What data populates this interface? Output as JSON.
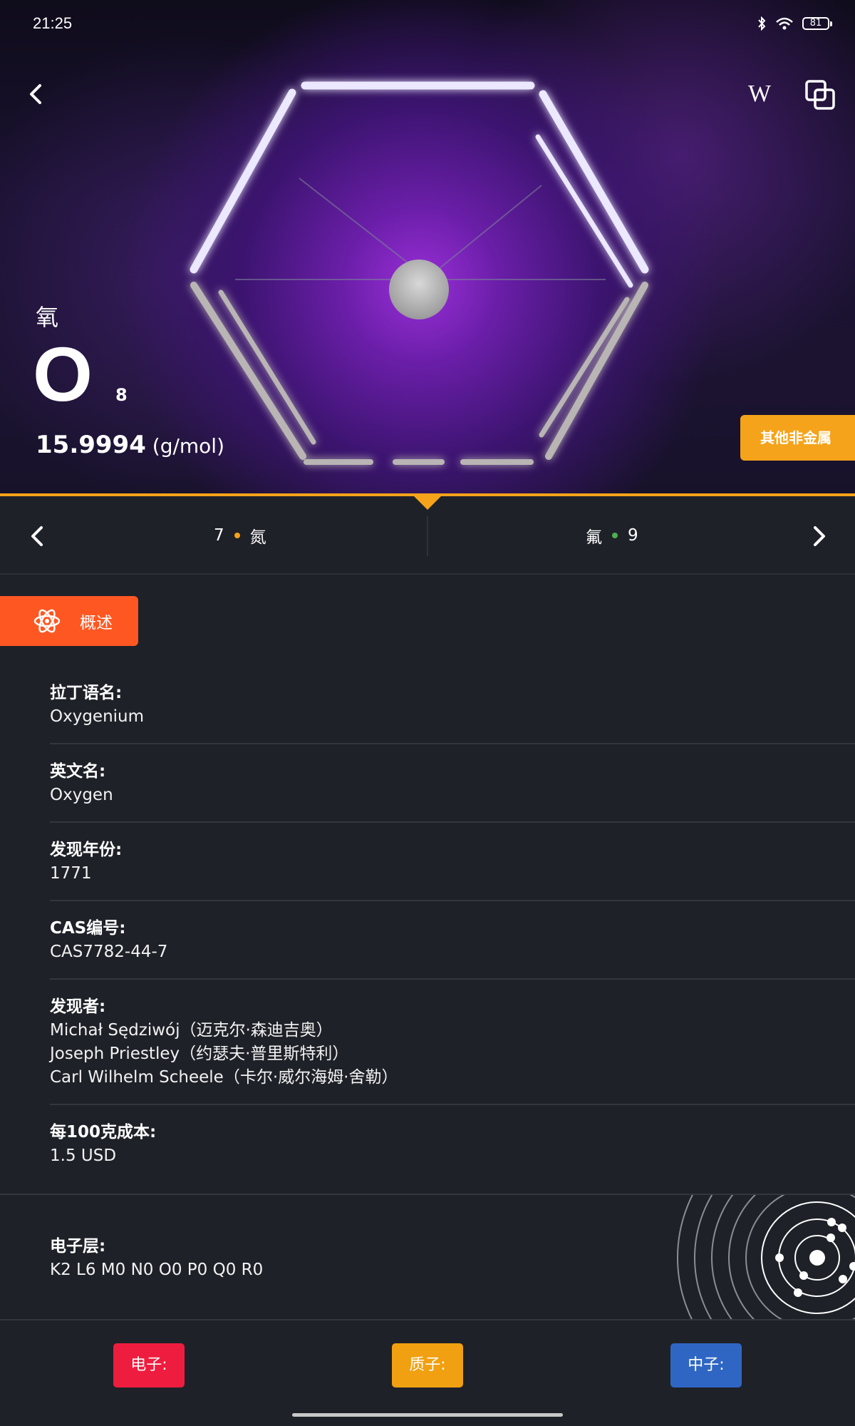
{
  "status_bar": {
    "time": "21:25",
    "battery": "81"
  },
  "header": {
    "wiki_label": "W"
  },
  "element": {
    "name_cn": "氧",
    "symbol": "O",
    "atomic_number": "8",
    "mass_value": "15.9994",
    "mass_unit": "(g/mol)",
    "category": "其他非金属",
    "category_color": "#f5a31a"
  },
  "nav": {
    "prev": {
      "number": "7",
      "name": "氮",
      "dot_color": "#f5a31a"
    },
    "next": {
      "number": "9",
      "name": "氟",
      "dot_color": "#4caf50"
    }
  },
  "tab": {
    "label": "概述",
    "color": "#ff5722"
  },
  "details": [
    {
      "label": "拉丁语名:",
      "value": "Oxygenium"
    },
    {
      "label": "英文名:",
      "value": "Oxygen"
    },
    {
      "label": "发现年份:",
      "value": "1771"
    },
    {
      "label": "CAS编号:",
      "value": "CAS7782-44-7"
    },
    {
      "label": "发现者:",
      "value": "Michał Sędziwój（迈克尔·森迪吉奥）",
      "value2": "Joseph Priestley（约瑟夫·普里斯特利）",
      "value3": "Carl Wilhelm Scheele（卡尔·威尔海姆·舍勒）"
    },
    {
      "label": "每100克成本:",
      "value": "1.5 USD"
    }
  ],
  "shells": {
    "label": "电子层:",
    "value": "K2 L6 M0 N0 O0 P0 Q0 R0"
  },
  "particles": [
    {
      "label": "电子:",
      "color": "#ee1d3f"
    },
    {
      "label": "质子:",
      "color": "#f0a010"
    },
    {
      "label": "中子:",
      "color": "#2f66c4"
    }
  ]
}
